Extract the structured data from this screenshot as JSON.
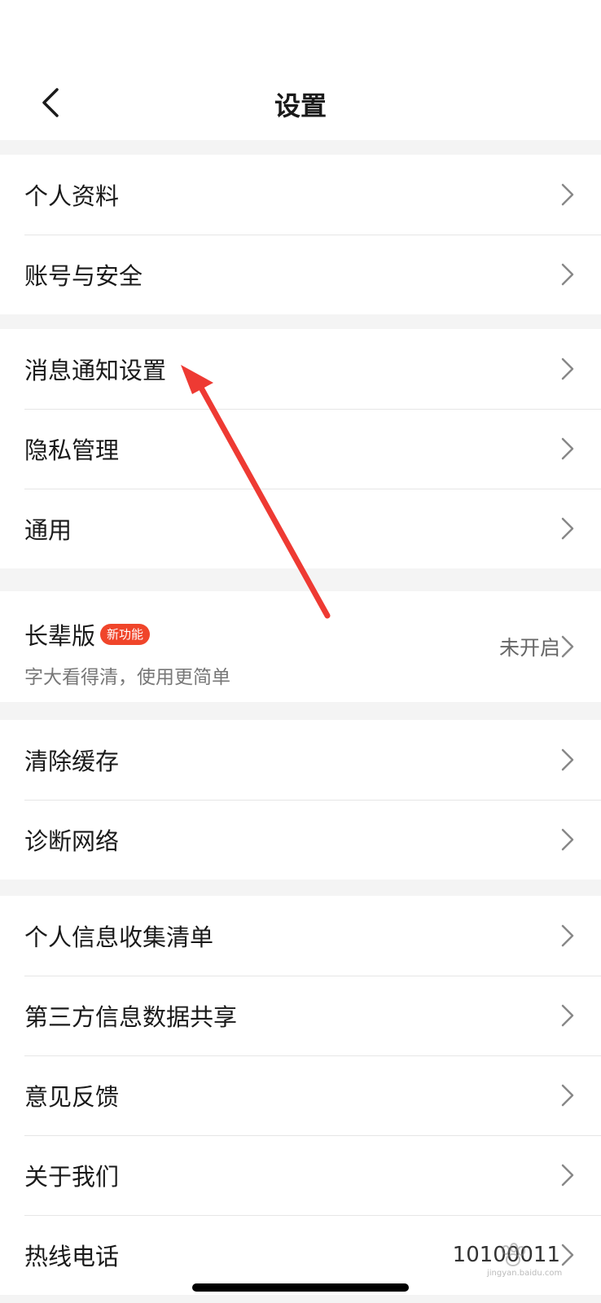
{
  "header": {
    "title": "设置"
  },
  "groups": {
    "g1": [
      {
        "label": "个人资料"
      },
      {
        "label": "账号与安全"
      }
    ],
    "g2": [
      {
        "label": "消息通知设置"
      },
      {
        "label": "隐私管理"
      },
      {
        "label": "通用"
      }
    ],
    "elder": {
      "title": "长辈版",
      "badge": "新功能",
      "subtitle": "字大看得清，使用更简单",
      "status": "未开启"
    },
    "g4": [
      {
        "label": "清除缓存"
      },
      {
        "label": "诊断网络"
      }
    ],
    "g5": [
      {
        "label": "个人信息收集清单"
      },
      {
        "label": "第三方信息数据共享"
      },
      {
        "label": "意见反馈"
      },
      {
        "label": "关于我们"
      },
      {
        "label": "热线电话",
        "value": "10100011"
      }
    ]
  },
  "watermark": {
    "text": "jingyan.baidu.com"
  },
  "colors": {
    "badge": "#f0452a",
    "annotation_arrow": "#ee3a33"
  }
}
